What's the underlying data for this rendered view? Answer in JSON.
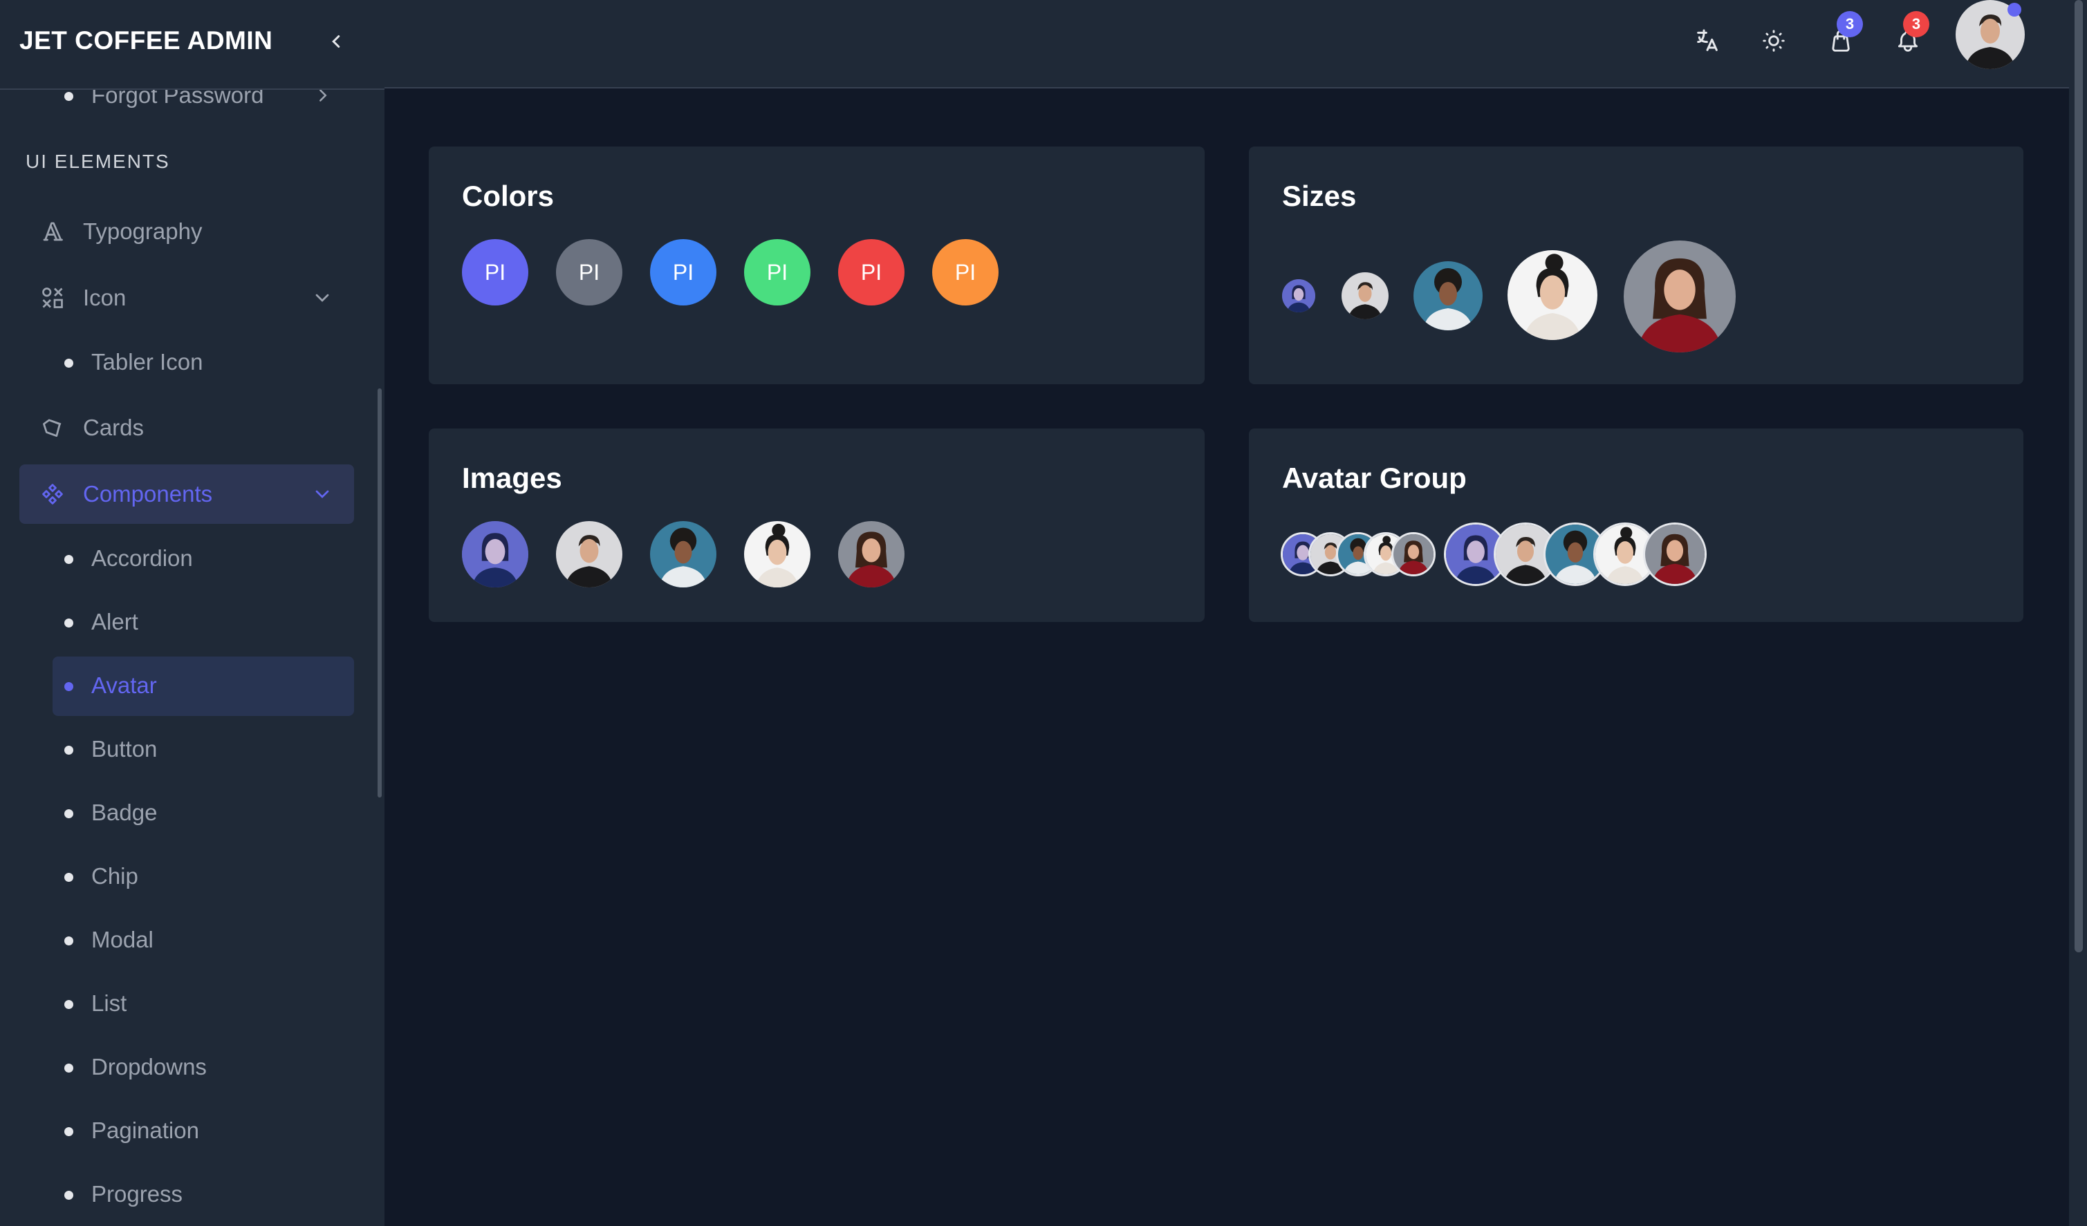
{
  "brand": "JET COFFEE ADMIN",
  "sidebar": {
    "partial_item": "Forgot Password",
    "section_title": "UI ELEMENTS",
    "items": [
      {
        "label": "Typography"
      },
      {
        "label": "Icon"
      },
      {
        "label": "Tabler Icon"
      },
      {
        "label": "Cards"
      },
      {
        "label": "Components"
      }
    ],
    "sub_items": [
      "Accordion",
      "Alert",
      "Avatar",
      "Button",
      "Badge",
      "Chip",
      "Modal",
      "List",
      "Dropdowns",
      "Pagination",
      "Progress"
    ],
    "active_item": "Components",
    "active_sub_item": "Avatar"
  },
  "topbar": {
    "cart_count": "3",
    "notification_count": "3",
    "icons": [
      "translate-icon",
      "sun-icon",
      "shopping-bag-icon",
      "bell-icon"
    ]
  },
  "cards": {
    "colors": {
      "title": "Colors",
      "avatars": [
        {
          "text": "PI",
          "color": "#6366f1"
        },
        {
          "text": "PI",
          "color": "#6b7280"
        },
        {
          "text": "PI",
          "color": "#3b82f6"
        },
        {
          "text": "PI",
          "color": "#4ade80"
        },
        {
          "text": "PI",
          "color": "#ef4444"
        },
        {
          "text": "PI",
          "color": "#fb923c"
        }
      ]
    },
    "sizes": {
      "title": "Sizes"
    },
    "images": {
      "title": "Images"
    },
    "avatar_group": {
      "title": "Avatar Group"
    }
  },
  "colors": {
    "background": "#111827",
    "surface": "#1f2937",
    "accent": "#6366f1",
    "badge_blue": "#6366f1",
    "badge_red": "#ef4444"
  }
}
